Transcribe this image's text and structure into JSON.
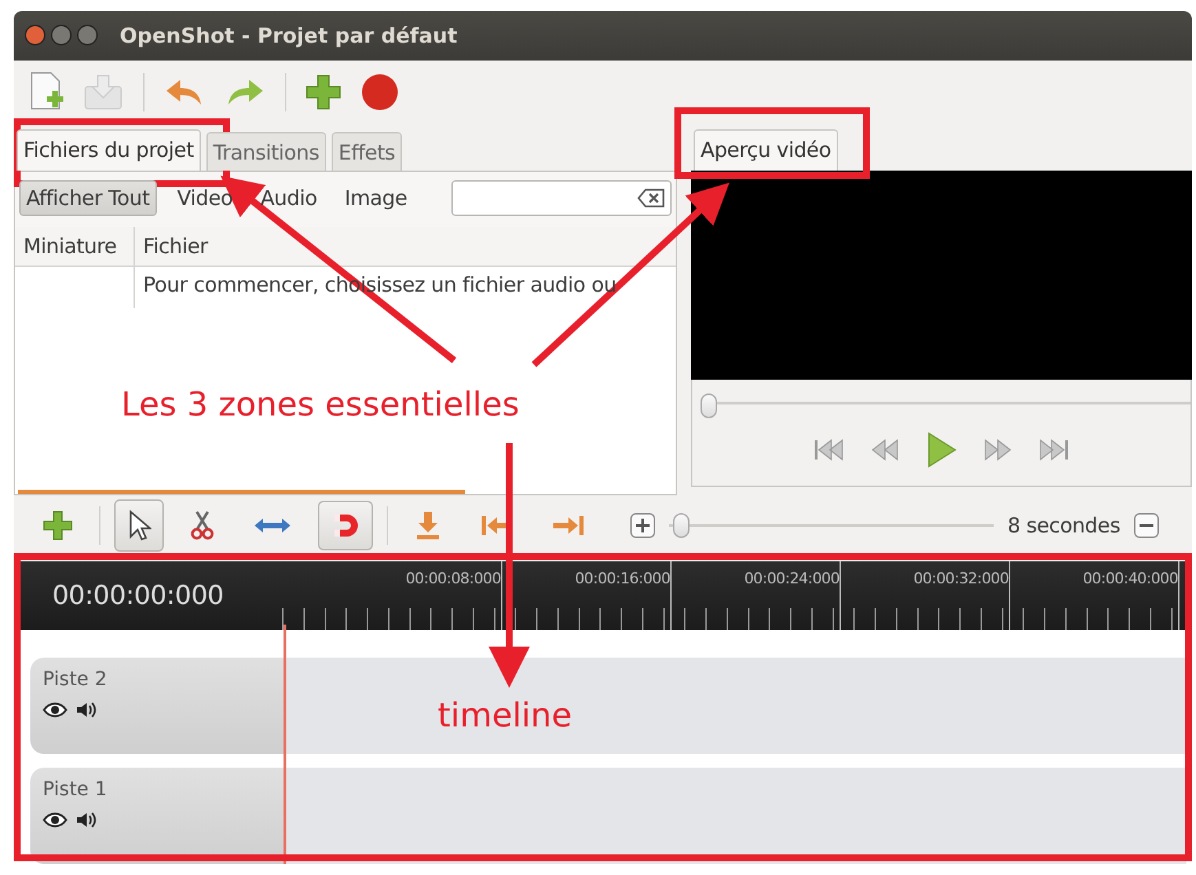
{
  "window": {
    "title": "OpenShot - Projet par défaut"
  },
  "project_tabs": [
    {
      "label": "Fichiers du projet",
      "selected": true
    },
    {
      "label": "Transitions",
      "selected": false
    },
    {
      "label": "Effets",
      "selected": false
    }
  ],
  "filters": [
    {
      "label": "Afficher Tout",
      "selected": true
    },
    {
      "label": "Video",
      "selected": false
    },
    {
      "label": "Audio",
      "selected": false
    },
    {
      "label": "Image",
      "selected": false
    }
  ],
  "files_table": {
    "columns": [
      "Miniature",
      "Fichier"
    ],
    "hint": "Pour commencer, choisissez un fichier audio ou"
  },
  "preview_tabs": [
    {
      "label": "Aperçu vidéo",
      "selected": true
    }
  ],
  "preview": {
    "level": 0
  },
  "tools": [
    {
      "kind": "add",
      "selected": false
    },
    {
      "kind": "pointer",
      "selected": true
    },
    {
      "kind": "razor",
      "selected": false
    },
    {
      "kind": "resize",
      "selected": false
    },
    {
      "kind": "snap",
      "selected": true
    },
    {
      "kind": "marker",
      "selected": false
    },
    {
      "kind": "previous",
      "selected": false
    },
    {
      "kind": "next",
      "selected": false
    }
  ],
  "zoom": {
    "level": 0.04,
    "reading": "8 secondes"
  },
  "timeline": {
    "time": "00:00:00:000",
    "ticks": [
      "00:00:08:000",
      "00:00:16:000",
      "00:00:24:000",
      "00:00:32:000",
      "00:00:40:000"
    ],
    "tracks": [
      {
        "name": "Piste 2"
      },
      {
        "name": "Piste 1"
      }
    ]
  },
  "annotations": {
    "caption": "Les 3 zones essentielles",
    "timeline_label": "timeline"
  }
}
